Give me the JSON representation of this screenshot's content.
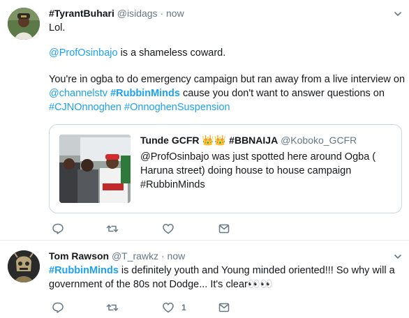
{
  "colors": {
    "link": "#1da1f2",
    "muted": "#657786",
    "border": "#e6ecf0"
  },
  "tweets": [
    {
      "name": "#TyrantBuhari",
      "handle": "@isidags",
      "dot": "·",
      "time": "now",
      "lines": {
        "l1": "Lol.",
        "l2_mention": "@ProfOsinbajo",
        "l2_rest": " is a shameless coward.",
        "l3": "You're in ogba to do emergency campaign but ran away from a live interview on",
        "l4_mention": "@channelstv",
        "l4_hashtag": "#RubbinMinds",
        "l4_rest": " cause you don't want to answer questions on",
        "l5_tag1": "#CJNOnnoghen",
        "l5_tag2": "#OnnoghenSuspension"
      },
      "quote": {
        "name": "Tunde GCFR",
        "emoji": "👑👑",
        "tag": "#BBNAIJA",
        "handle": "@Koboko_GCFR",
        "line1": "@ProfOsinbajo was just spotted here around Ogba (",
        "line2": "Haruna street) doing house to house campaign",
        "line3": "#RubbinMinds"
      },
      "actions": {
        "like_count": ""
      }
    },
    {
      "name": "Tom Rawson",
      "handle": "@T_rawkz",
      "dot": "·",
      "time": "now",
      "lines": {
        "l1_hashtag": "#RubbinMinds",
        "l1_rest": " is definitely youth and Young minded oriented!!! So why will a",
        "l2": "government of the 80s not Dodge... It's clear👀👀"
      },
      "actions": {
        "like_count": "1"
      }
    }
  ]
}
